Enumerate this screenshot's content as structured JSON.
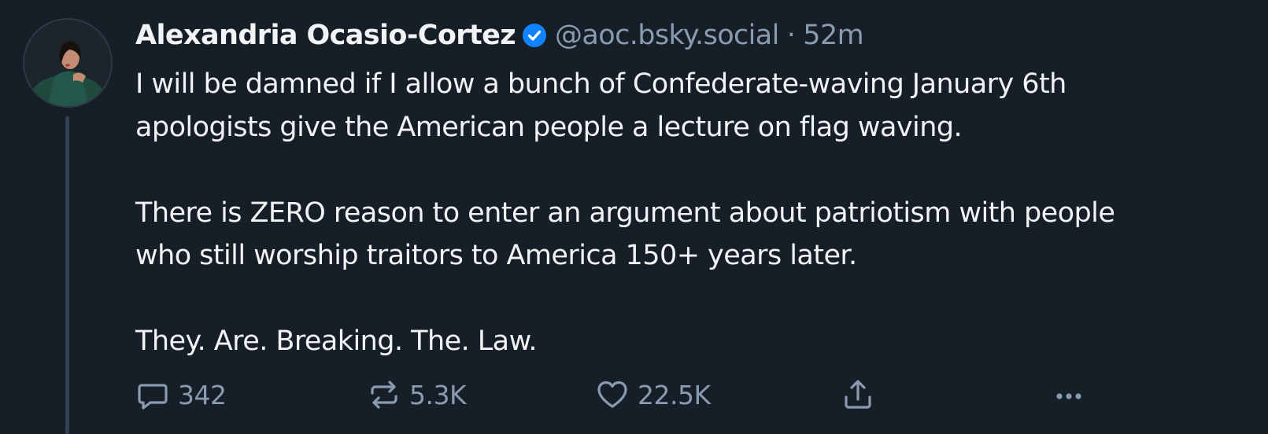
{
  "post": {
    "author": {
      "display_name": "Alexandria Ocasio-Cortez",
      "handle": "@aoc.bsky.social",
      "verified": true,
      "separator": "·",
      "time_ago": "52m"
    },
    "paragraphs": [
      {
        "lines": [
          "I will be damned if I allow a bunch of Confederate-waving January 6th",
          "apologists give the American people a lecture on flag waving."
        ]
      },
      {
        "lines": [
          "There is ZERO reason to enter an argument about patriotism with people",
          "who still worship traitors to America 150+ years later."
        ]
      },
      {
        "lines": [
          "They. Are. Breaking. The. Law."
        ]
      }
    ],
    "actions": {
      "reply": {
        "icon": "reply-icon",
        "count": "342"
      },
      "repost": {
        "icon": "repost-icon",
        "count": "5.3K"
      },
      "like": {
        "icon": "heart-icon",
        "count": "22.5K"
      },
      "share": {
        "icon": "share-icon"
      },
      "more": {
        "icon": "more-icon"
      }
    }
  },
  "colors": {
    "background": "#161e27",
    "text": "#f1f3f5",
    "muted": "#8a9bb0",
    "verified_badge": "#1083fe",
    "thread_line": "#334252"
  }
}
